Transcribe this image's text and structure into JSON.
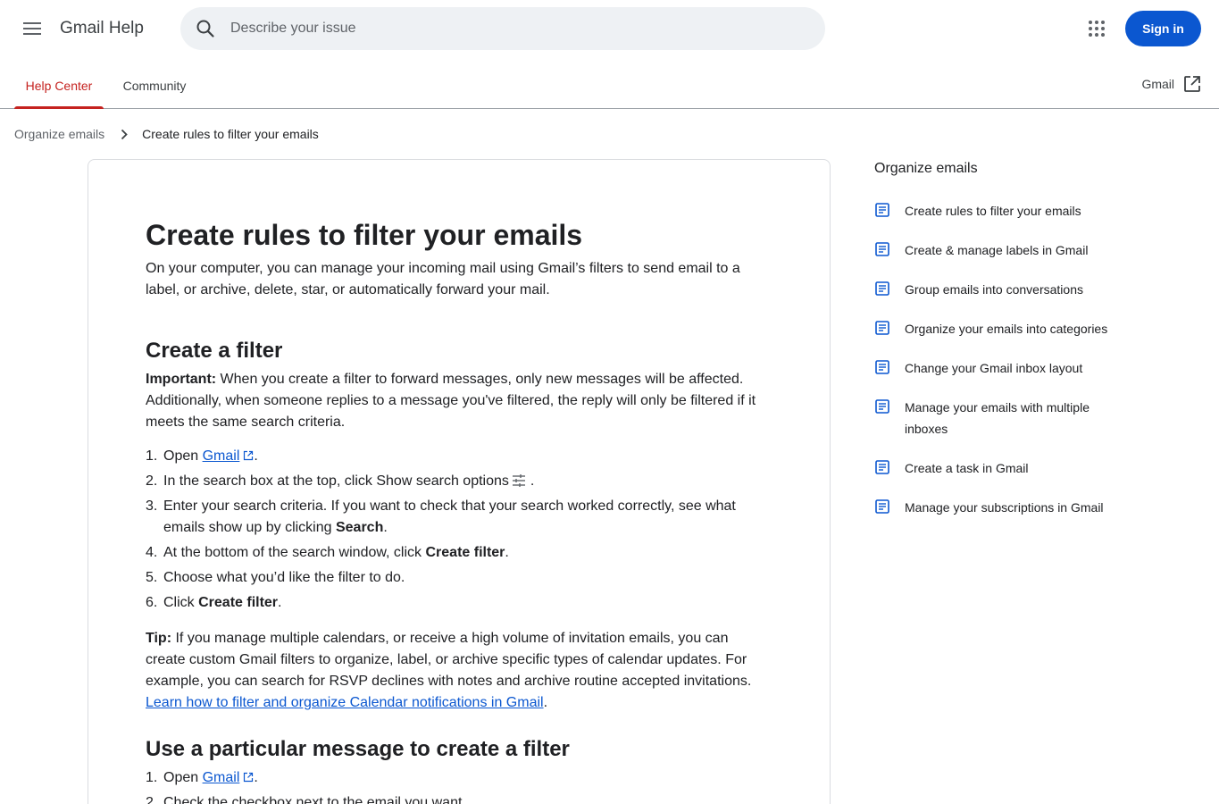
{
  "header": {
    "app_title": "Gmail Help",
    "search_placeholder": "Describe your issue",
    "sign_in_label": "Sign in"
  },
  "tabs": [
    {
      "label": "Help Center",
      "active": true
    },
    {
      "label": "Community",
      "active": false
    }
  ],
  "gmail_link_label": "Gmail",
  "breadcrumb": {
    "parent": "Organize emails",
    "current": "Create rules to filter your emails"
  },
  "article": {
    "title": "Create rules to filter your emails",
    "intro": "On your computer, you can manage your incoming mail using Gmail’s filters to send email to a label, or archive, delete, star, or automatically forward your mail.",
    "section1": {
      "heading": "Create a filter",
      "important_label": "Important:",
      "important_text": " When you create a filter to forward messages, only new messages will be affected. Additionally, when someone replies to a message you've filtered, the reply will only be filtered if it meets the same search criteria.",
      "steps": {
        "s1_num": "1.",
        "s1_text": "Open ",
        "s1_link": "Gmail",
        "s1_end": ".",
        "s2_num": "2.",
        "s2_text": "In the search box at the top, click Show search options",
        "s2_end": ".",
        "s3_num": "3.",
        "s3_text": "Enter your search criteria. If you want to check that your search worked correctly, see what emails show up by clicking ",
        "s3_bold": "Search",
        "s3_end": ".",
        "s4_num": "4.",
        "s4_text": "At the bottom of the search window, click ",
        "s4_bold": "Create filter",
        "s4_end": ".",
        "s5_num": "5.",
        "s5_text": "Choose what you’d like the filter to do.",
        "s6_num": "6.",
        "s6_text": "Click ",
        "s6_bold": "Create filter",
        "s6_end": "."
      },
      "tip_label": "Tip:",
      "tip_text": " If you manage multiple calendars, or receive a high volume of invitation emails, you can create custom Gmail filters to organize, label, or archive specific types of calendar updates. For example, you can search for RSVP declines with notes and archive routine accepted invitations. ",
      "tip_link": "Learn how to filter and organize Calendar notifications in Gmail",
      "tip_end": "."
    },
    "section2": {
      "heading": "Use a particular message to create a filter",
      "s1_num": "1.",
      "s1_text": "Open ",
      "s1_link": "Gmail",
      "s1_end": ".",
      "s2_num": "2.",
      "s2_text": "Check the checkbox next to the email you want."
    }
  },
  "sidenav": {
    "title": "Organize emails",
    "items": [
      "Create rules to filter your emails",
      "Create & manage labels in Gmail",
      "Group emails into conversations",
      "Organize your emails into categories",
      "Change your Gmail inbox layout",
      "Manage your emails with multiple inboxes",
      "Create a task in Gmail",
      "Manage your subscriptions in Gmail"
    ]
  },
  "colors": {
    "accent_red": "#c5221f",
    "primary_blue": "#0b57d0",
    "search_bg": "#eef1f4"
  }
}
